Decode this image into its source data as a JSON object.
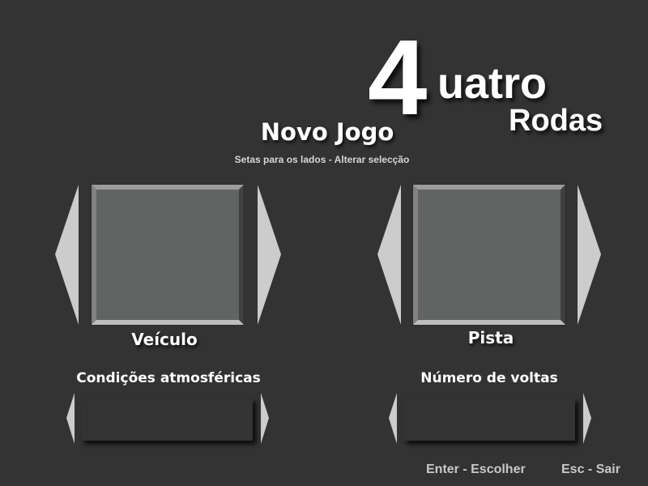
{
  "logo": {
    "four": "4",
    "uatro": "uatro",
    "rodas": "Rodas"
  },
  "screen": {
    "title": "Novo Jogo",
    "subtitle": "Setas para os lados - Alterar selecção"
  },
  "vehicle": {
    "label": "Veículo"
  },
  "track": {
    "label": "Pista"
  },
  "weather": {
    "label": "Condições atmosféricas",
    "value": ""
  },
  "laps": {
    "label": "Número de voltas",
    "value": ""
  },
  "footer": {
    "enter": "Enter - Escolher",
    "esc": "Esc - Sair"
  },
  "colors": {
    "background": "#333333",
    "arrow": "#cccccc",
    "preview": "#626463"
  },
  "icons": [
    "arrow-left-icon",
    "arrow-right-icon"
  ]
}
